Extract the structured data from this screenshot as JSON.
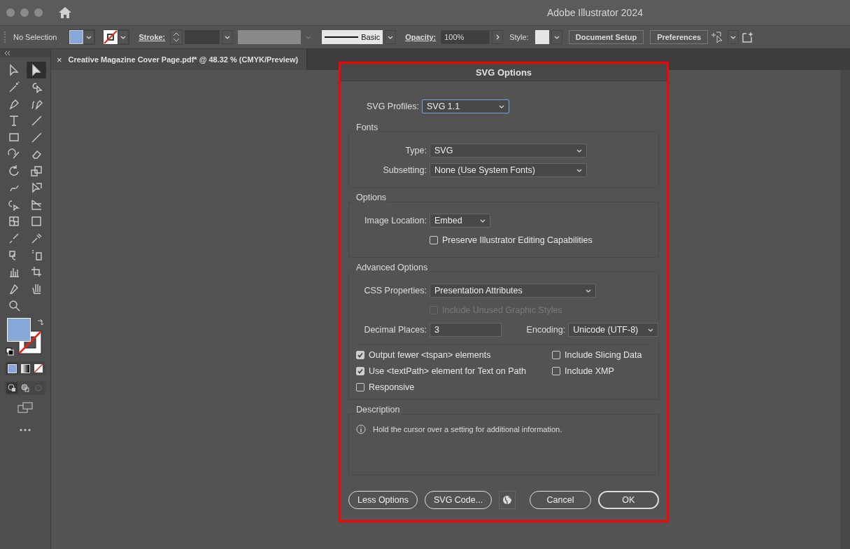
{
  "window": {
    "title": "Adobe Illustrator 2024"
  },
  "control_bar": {
    "selection": "No Selection",
    "stroke_label": "Stroke:",
    "stroke_style": "Basic",
    "opacity_label": "Opacity:",
    "opacity_value": "100%",
    "style_label": "Style:",
    "buttons": [
      "Document Setup",
      "Preferences"
    ]
  },
  "document_tab": {
    "close": "×",
    "title": "Creative Magazine Cover Page.pdf* @ 48.32 % (CMYK/Preview)"
  },
  "tools": [
    {
      "selected": false
    },
    {
      "selected": true
    },
    {
      "selected": false
    },
    {
      "selected": false
    },
    {
      "selected": false
    },
    {
      "selected": false
    },
    {
      "selected": false
    },
    {
      "selected": false
    },
    {
      "selected": false
    },
    {
      "selected": false
    },
    {
      "selected": false
    },
    {
      "selected": false
    },
    {
      "selected": false
    },
    {
      "selected": false
    },
    {
      "selected": false
    },
    {
      "selected": false
    },
    {
      "selected": false
    },
    {
      "selected": false
    },
    {
      "selected": false
    },
    {
      "selected": false
    },
    {
      "selected": false
    },
    {
      "selected": false
    },
    {
      "selected": false
    },
    {
      "selected": false
    },
    {
      "selected": false
    },
    {
      "selected": false
    },
    {
      "selected": false
    },
    {
      "selected": false
    },
    {
      "selected": false
    }
  ],
  "dialog": {
    "title": "SVG Options",
    "profile": {
      "label": "SVG Profiles:",
      "value": "SVG 1.1"
    },
    "fonts": {
      "heading": "Fonts",
      "type_label": "Type:",
      "type_value": "SVG",
      "subsetting_label": "Subsetting:",
      "subsetting_value": "None (Use System Fonts)"
    },
    "options": {
      "heading": "Options",
      "image_location_label": "Image Location:",
      "image_location_value": "Embed",
      "preserve": {
        "label": "Preserve Illustrator Editing Capabilities",
        "checked": false,
        "disabled": false
      }
    },
    "advanced": {
      "heading": "Advanced Options",
      "css_label": "CSS Properties:",
      "css_value": "Presentation Attributes",
      "unused_styles": {
        "label": "Include Unused Graphic Styles",
        "checked": false,
        "disabled": true
      },
      "decimal_label": "Decimal Places:",
      "decimal_value": "3",
      "encoding_label": "Encoding:",
      "encoding_value": "Unicode (UTF-8)",
      "checks": [
        {
          "label": "Output fewer <tspan> elements",
          "checked": true,
          "disabled": false
        },
        {
          "label": "Include Slicing Data",
          "checked": false,
          "disabled": false
        },
        {
          "label": "Use <textPath> element for Text on Path",
          "checked": true,
          "disabled": false
        },
        {
          "label": "Include XMP",
          "checked": false,
          "disabled": false
        },
        {
          "label": "Responsive",
          "checked": false,
          "disabled": false
        }
      ]
    },
    "description": {
      "heading": "Description",
      "text": "Hold the cursor over a setting for additional information."
    },
    "buttons": [
      {
        "label": "Less Options",
        "default": false
      },
      {
        "label": "SVG Code...",
        "default": false
      },
      {
        "label": "Cancel",
        "default": false
      },
      {
        "label": "OK",
        "default": true
      }
    ]
  }
}
